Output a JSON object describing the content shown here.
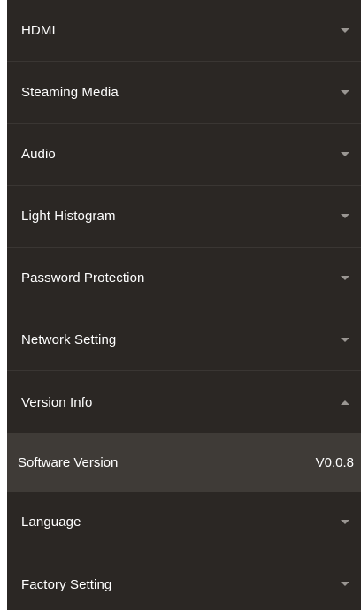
{
  "menu": {
    "items": [
      {
        "label": "HDMI",
        "expanded": false
      },
      {
        "label": "Steaming Media",
        "expanded": false
      },
      {
        "label": "Audio",
        "expanded": false
      },
      {
        "label": "Light Histogram",
        "expanded": false
      },
      {
        "label": "Password Protection",
        "expanded": false
      },
      {
        "label": "Network Setting",
        "expanded": false
      },
      {
        "label": "Version Info",
        "expanded": true
      },
      {
        "label": "Language",
        "expanded": false
      },
      {
        "label": "Factory Setting",
        "expanded": false
      }
    ],
    "version_info": {
      "software_version_label": "Software Version",
      "software_version_value": "V0.0.8"
    }
  },
  "colors": {
    "panel_bg": "#2b2724",
    "subrow_bg": "#3f3b37",
    "divider": "#3a3633",
    "chevron": "#9a9692",
    "text": "#ffffff"
  }
}
